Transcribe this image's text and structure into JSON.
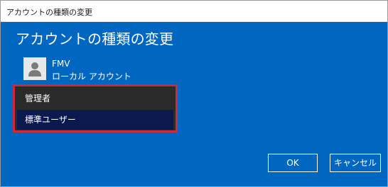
{
  "window": {
    "title": "アカウントの種類の変更"
  },
  "main": {
    "heading": "アカウントの種類の変更",
    "user": {
      "name": "FMV",
      "type": "ローカル アカウント"
    },
    "account_type_options": [
      {
        "label": "管理者",
        "selected": false
      },
      {
        "label": "標準ユーザー",
        "selected": true
      }
    ]
  },
  "buttons": {
    "ok_label": "OK",
    "cancel_label": "キャンセル"
  },
  "colors": {
    "accent": "#0067c0",
    "highlight_outline": "#d0283a",
    "selected_option": "#0a1a4f",
    "dropdown_bg": "#2b2b2b"
  },
  "icons": {
    "avatar": "user-avatar-icon"
  }
}
